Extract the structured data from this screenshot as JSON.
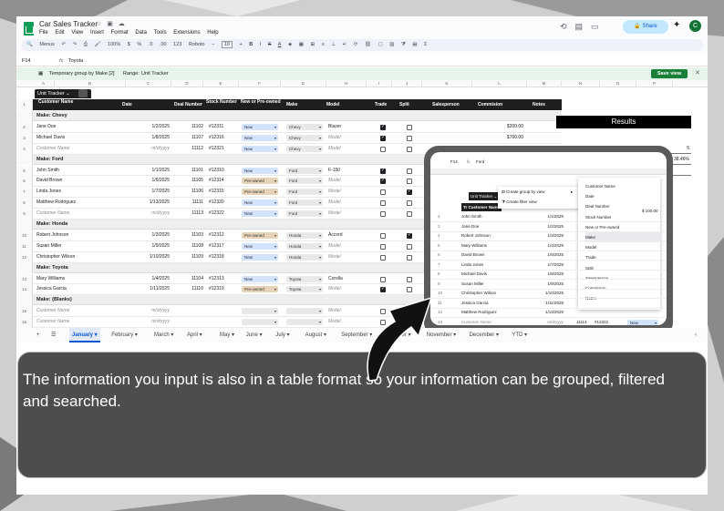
{
  "app": {
    "title": "Car Sales Tracker",
    "menu": [
      "File",
      "Edit",
      "View",
      "Insert",
      "Format",
      "Data",
      "Tools",
      "Extensions",
      "Help"
    ],
    "share_label": "Share",
    "avatar_letter": "C"
  },
  "toolbar": {
    "menus_label": "Menus",
    "zoom": "100%",
    "currency": "$",
    "percent": "%",
    "dec_decrease": ".0",
    "dec_increase": ".00",
    "number_format": "123",
    "font": "Roboto",
    "font_size": "10"
  },
  "formula": {
    "cell_ref": "F14",
    "fx": "fx",
    "value": "Toyota"
  },
  "group_bar": {
    "text": "Temporary group by Make [2]",
    "range_label": "Range:",
    "range_value": "Unit Tracker",
    "save_label": "Save view"
  },
  "columns": [
    "A",
    "B",
    "C",
    "D",
    "E",
    "F",
    "G",
    "H",
    "I",
    "J",
    "K",
    "L",
    "M",
    "N",
    "O",
    "P"
  ],
  "table": {
    "tab_name": "Unit Tracker",
    "headers": [
      "Customer Name",
      "Date",
      "Deal Number",
      "Stock Number",
      "New or Pre-owned",
      "Make",
      "Model",
      "Trade",
      "Split",
      "Salesperson",
      "Commision",
      "Notes"
    ],
    "groups": [
      {
        "label": "Make: Chevy",
        "rownum": "",
        "rows": [
          {
            "n": "2",
            "name": "Jane Doe",
            "date": "1/2/2025",
            "deal": "11102",
            "stock": "#12311",
            "type": "New",
            "make": "Chevy",
            "model": "Blazer",
            "trade": true,
            "split": false,
            "comm": "$200.00"
          },
          {
            "n": "3",
            "name": "Michael Davis",
            "date": "1/8/2025",
            "deal": "11107",
            "stock": "#12316",
            "type": "New",
            "make": "Chevy",
            "model": "Model",
            "trade": true,
            "split": false,
            "comm": "$700.00"
          },
          {
            "n": "4",
            "name": "Customer Name",
            "date": "m/d/yyyy",
            "deal": "11112",
            "stock": "#12321",
            "type": "New",
            "make": "Chevy",
            "model": "Model",
            "trade": false,
            "split": false,
            "comm": "$500.00",
            "placeholder": true
          }
        ]
      },
      {
        "label": "Make: Ford",
        "rows": [
          {
            "n": "5",
            "name": "John Smith",
            "date": "1/1/2025",
            "deal": "11101",
            "stock": "#12310",
            "type": "New",
            "make": "Ford",
            "model": "F-150",
            "trade": true,
            "split": false,
            "comm": ""
          },
          {
            "n": "6",
            "name": "David Brown",
            "date": "1/6/2025",
            "deal": "11105",
            "stock": "#12314",
            "type": "Pre-owned",
            "make": "Ford",
            "model": "Model",
            "trade": true,
            "split": false,
            "comm": ""
          },
          {
            "n": "7",
            "name": "Linda Jones",
            "date": "1/7/2025",
            "deal": "11106",
            "stock": "#12315",
            "type": "Pre-owned",
            "make": "Ford",
            "model": "Model",
            "trade": false,
            "split": true,
            "comm": ""
          },
          {
            "n": "8",
            "name": "Matthew Rodriguez",
            "date": "1/13/2025",
            "deal": "11111",
            "stock": "#12320",
            "type": "New",
            "make": "Ford",
            "model": "Model",
            "trade": false,
            "split": false,
            "comm": ""
          },
          {
            "n": "9",
            "name": "Customer Name",
            "date": "m/d/yyyy",
            "deal": "11113",
            "stock": "#12322",
            "type": "New",
            "make": "Ford",
            "model": "Model",
            "trade": false,
            "split": false,
            "comm": "",
            "placeholder": true
          }
        ]
      },
      {
        "label": "Make: Honda",
        "rows": [
          {
            "n": "10",
            "name": "Robert Johnson",
            "date": "1/3/2025",
            "deal": "11103",
            "stock": "#12312",
            "type": "Pre-owned",
            "make": "Honda",
            "model": "Accord",
            "trade": false,
            "split": true,
            "comm": ""
          },
          {
            "n": "11",
            "name": "Susan Miller",
            "date": "1/9/2025",
            "deal": "11108",
            "stock": "#12317",
            "type": "New",
            "make": "Honda",
            "model": "Model",
            "trade": false,
            "split": false,
            "comm": ""
          },
          {
            "n": "12",
            "name": "Christopher Wilson",
            "date": "1/10/2025",
            "deal": "11109",
            "stock": "#12318",
            "type": "New",
            "make": "Honda",
            "model": "Model",
            "trade": false,
            "split": false,
            "comm": ""
          }
        ]
      },
      {
        "label": "Make: Toyota",
        "rows": [
          {
            "n": "13",
            "name": "Mary Williams",
            "date": "1/4/2025",
            "deal": "11104",
            "stock": "#12313",
            "type": "New",
            "make": "Toyota",
            "model": "Corolla",
            "trade": false,
            "split": false,
            "comm": ""
          },
          {
            "n": "14",
            "name": "Jessica Garcia",
            "date": "1/11/2025",
            "deal": "11110",
            "stock": "#12319",
            "type": "Pre-owned",
            "make": "Toyota",
            "model": "Model",
            "trade": true,
            "split": false,
            "comm": ""
          }
        ]
      },
      {
        "label": "Make: (Blanks)",
        "rows": [
          {
            "n": "15",
            "name": "Customer Name",
            "date": "m/d/yyyy",
            "deal": "",
            "stock": "",
            "type": "",
            "make": "",
            "model": "Model",
            "trade": false,
            "split": false,
            "comm": "",
            "placeholder": true
          },
          {
            "n": "16",
            "name": "Customer Name",
            "date": "m/d/yyyy",
            "deal": "",
            "stock": "",
            "type": "",
            "make": "",
            "model": "Model",
            "trade": false,
            "split": false,
            "comm": "",
            "placeholder": true
          }
        ]
      }
    ]
  },
  "results": {
    "title": "Results",
    "rows": [
      {
        "label": "New:",
        "value": "8",
        "label2": "Trades:",
        "value2": "5"
      },
      {
        "label": "Pre-Owned:",
        "value": "5",
        "label2": "Trade Percentage",
        "value2": "38.46%"
      },
      {
        "label": "Splits:",
        "value": "",
        "label2": "",
        "value2": ""
      }
    ]
  },
  "inset": {
    "cell_ref": "F14",
    "fx": "fx",
    "value": "Ford",
    "tab_name": "Unit Tracker",
    "header": "Customer Name",
    "names": [
      "John Smith",
      "Jane Doe",
      "Robert Johnson",
      "Mary Williams",
      "David Brown",
      "Linda Jones",
      "Michael Davis",
      "Susan Miller",
      "Christopher Wilson",
      "Jessica Garcia",
      "Matthew Rodriguez",
      "Customer Name",
      "Customer Name",
      "Customer Name"
    ],
    "dates": [
      "1/1/2025",
      "1/2/2025",
      "1/3/2025",
      "1/4/2025",
      "1/6/2025",
      "1/7/2025",
      "1/8/2025",
      "1/9/2025",
      "1/10/2025",
      "1/11/2025",
      "1/13/2025",
      "m/d/yyyy",
      "m/d/yyyy",
      ""
    ],
    "context_menu": [
      "Create group by view",
      "Create filter view"
    ],
    "submenu": [
      "Customer Name",
      "Date",
      "Deal Number",
      "Stock Number",
      "New or Pre-owned",
      "Make",
      "Model",
      "Trade",
      "Split",
      "Salesperson",
      "Commision",
      "Notes"
    ],
    "partial_value": "$ 100.00",
    "row_extra": {
      "deal": "11113",
      "stock": "#12322",
      "type": "New"
    }
  },
  "sheet_tabs": [
    "January",
    "February",
    "March",
    "April",
    "May",
    "June",
    "July",
    "August",
    "September",
    "October",
    "November",
    "December",
    "YTD"
  ],
  "active_tab": "January",
  "caption": "The information you input is also in a table format so your information can be grouped, filtered and searched."
}
